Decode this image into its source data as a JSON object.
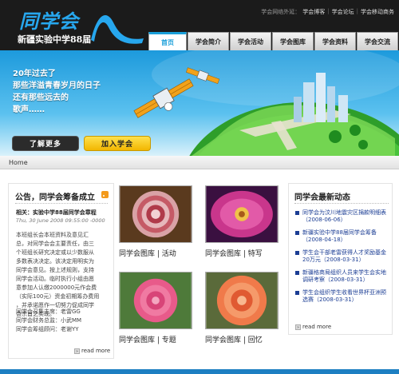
{
  "header": {
    "logo_title": "同学会",
    "logo_subtitle": "新疆实验中学88届",
    "toplinks": {
      "label": "学会网络外延：",
      "items": [
        "学会博客",
        "学会论坛",
        "学会移动商务"
      ]
    },
    "nav": [
      "首页",
      "学会简介",
      "学会活动",
      "学会图库",
      "学会资料",
      "学会交流"
    ]
  },
  "banner": {
    "lines": [
      "20年过去了",
      "那些洋溢青春岁月的日子",
      "还有那些远去的",
      "歌声……"
    ],
    "btn_more": "了解更多",
    "btn_join": "加入学会"
  },
  "breadcrumb": "Home",
  "notice": {
    "title": "公告，同学会筹备成立",
    "headline": "相关：实验中学88届同学会章程",
    "date": "Thu, 30 June 2008 09:55:00 -0000",
    "body": [
      "本班组长会本班资料及意见汇",
      "总，对同学会会主要责任，由三",
      "个班组长研究决定或以少数服从",
      "多数表决决定。该决定用明实为",
      "同学会意见。按上述规则，支持",
      "同学会活动。临时执行小组由愿",
      "意参加人认缴2000000元作会费",
      "（实际100元）资金初期筹办费用",
      "，并承诺愿作一切努力促成同学",
      "会宗旨之实现。"
    ],
    "signers": [
      "同学会召集主席：老雷GG",
      "同学会财务总监：小武MM",
      "同学会筹组顾问：老谢YY"
    ],
    "readmore": "read more"
  },
  "gallery": [
    {
      "caption": "同学会图库 | 活动"
    },
    {
      "caption": "同学会图库 | 特写"
    },
    {
      "caption": "同学会图库 | 专题"
    },
    {
      "caption": "同学会图库 | 回忆"
    }
  ],
  "news": {
    "title": "同学会最新动态",
    "items": [
      "同学会为汶川地震灾区捐款明细表（2008-06-06）",
      "新疆实验中学88届同学会筹备（2008-04-18）",
      "学生会干部老雷获得人才奖励基金20万元（2008-03-31）",
      "新疆格商局组织人员来学生会实地调研考察（2008-03-31）",
      "学生会组织学生收看世界杯亚洲预选赛（2008-03-31）"
    ],
    "readmore": "read more"
  },
  "colors": {
    "accent": "#1a9fd9",
    "header_bg": "#1b1b1b",
    "news_link": "#1b3d94",
    "join_button": "#f2b600"
  }
}
